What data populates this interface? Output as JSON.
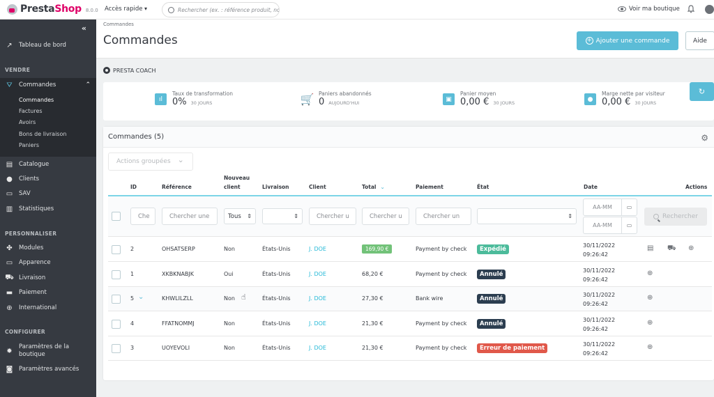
{
  "header": {
    "brand_prefix": "Presta",
    "brand_suffix": "Shop",
    "version": "8.0.0",
    "quick_access": "Accès rapide",
    "search_placeholder": "Rechercher (ex. : référence produit, no",
    "view_shop": "Voir ma boutique"
  },
  "sidebar": {
    "collapse": "«",
    "dashboard": "Tableau de bord",
    "sections": {
      "sell": "VENDRE",
      "customize": "PERSONNALISER",
      "configure": "CONFIGURER"
    },
    "orders": "Commandes",
    "orders_sub": [
      "Commandes",
      "Factures",
      "Avoirs",
      "Bons de livraison",
      "Paniers"
    ],
    "sell_items": [
      "Catalogue",
      "Clients",
      "SAV",
      "Statistiques"
    ],
    "customize_items": [
      "Modules",
      "Apparence",
      "Livraison",
      "Paiement",
      "International"
    ],
    "configure_items": [
      "Paramètres de la boutique",
      "Paramètres avancés"
    ]
  },
  "page": {
    "breadcrumb": "Commandes",
    "title": "Commandes",
    "add_button": "Ajouter une commande",
    "help_button": "Aide"
  },
  "coach": {
    "label": "PRESTA COACH",
    "kpis": [
      {
        "label": "Taux de transformation",
        "value": "0%",
        "period": "30 JOURS"
      },
      {
        "label": "Paniers abandonnés",
        "value": "0",
        "period": "AUJOURD'HUI"
      },
      {
        "label": "Panier moyen",
        "value": "0,00 €",
        "period": "30 JOURS"
      },
      {
        "label": "Marge nette par visiteur",
        "value": "0,00 €",
        "period": "30 JOURS"
      }
    ]
  },
  "orders": {
    "title": "Commandes (5)",
    "bulk_actions": "Actions groupées",
    "columns": {
      "id": "ID",
      "reference": "Référence",
      "new_client_1": "Nouveau",
      "new_client_2": "client",
      "delivery": "Livraison",
      "customer": "Client",
      "total": "Total",
      "payment": "Paiement",
      "status": "État",
      "date": "Date",
      "actions": "Actions"
    },
    "filters": {
      "id": "Che",
      "reference": "Chercher une",
      "new_client": "Tous",
      "delivery": "",
      "customer": "Chercher u",
      "total": "Chercher u",
      "payment": "Chercher un",
      "status": "",
      "date_from": "AA-MM",
      "date_to": "AA-MM",
      "search_button": "Rechercher"
    },
    "rows": [
      {
        "id": "2",
        "reference": "OHSATSERP",
        "new_client": "Non",
        "delivery": "États-Unis",
        "customer": "J. DOE",
        "total": "169,90 €",
        "payment": "Payment by check",
        "status": "Expédié",
        "date": "30/11/2022",
        "time": "09:26:42"
      },
      {
        "id": "1",
        "reference": "XKBKNABJK",
        "new_client": "Oui",
        "delivery": "États-Unis",
        "customer": "J. DOE",
        "total": "68,20 €",
        "payment": "Payment by check",
        "status": "Annulé",
        "date": "30/11/2022",
        "time": "09:26:42"
      },
      {
        "id": "5",
        "reference": "KHWLILZLL",
        "new_client": "Non",
        "delivery": "États-Unis",
        "customer": "J. DOE",
        "total": "27,30 €",
        "payment": "Bank wire",
        "status": "Annulé",
        "date": "30/11/2022",
        "time": "09:26:42"
      },
      {
        "id": "4",
        "reference": "FFATNOMMJ",
        "new_client": "Non",
        "delivery": "États-Unis",
        "customer": "J. DOE",
        "total": "21,30 €",
        "payment": "Payment by check",
        "status": "Annulé",
        "date": "30/11/2022",
        "time": "09:26:42"
      },
      {
        "id": "3",
        "reference": "UOYEVOLI",
        "new_client": "Non",
        "delivery": "États-Unis",
        "customer": "J. DOE",
        "total": "21,30 €",
        "payment": "Payment by check",
        "status": "Erreur de paiement",
        "date": "30/11/2022",
        "time": "09:26:42"
      }
    ]
  },
  "colors": {
    "accent": "#5bbcd7",
    "sidebar_bg": "#363a41",
    "status_shipped": "#4cbb9b",
    "status_cancelled": "#2c3e50",
    "status_error": "#e0584a",
    "total_highlight": "#72c279",
    "link": "#25b9d7"
  }
}
